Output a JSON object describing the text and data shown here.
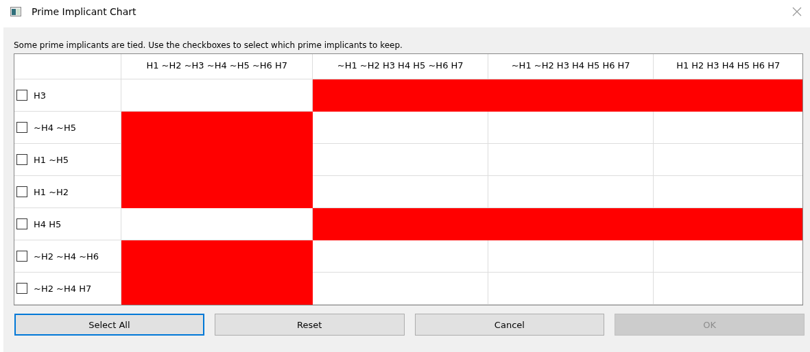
{
  "window": {
    "title": "Prime Implicant Chart"
  },
  "message": "Some prime implicants are tied. Use the checkboxes to select which prime implicants to keep.",
  "columns": [
    "H1 ~H2 ~H3 ~H4 ~H5 ~H6 H7",
    "~H1 ~H2 H3 H4 H5 ~H6 H7",
    "~H1 ~H2 H3 H4 H5 H6 H7",
    "H1 H2 H3 H4 H5 H6 H7"
  ],
  "rows": [
    {
      "label": "H3",
      "checked": false,
      "covers": [
        false,
        true,
        true,
        true
      ]
    },
    {
      "label": "~H4 ~H5",
      "checked": false,
      "covers": [
        true,
        false,
        false,
        false
      ]
    },
    {
      "label": "H1 ~H5",
      "checked": false,
      "covers": [
        true,
        false,
        false,
        false
      ]
    },
    {
      "label": "H1 ~H2",
      "checked": false,
      "covers": [
        true,
        false,
        false,
        false
      ]
    },
    {
      "label": "H4 H5",
      "checked": false,
      "covers": [
        false,
        true,
        true,
        true
      ]
    },
    {
      "label": "~H2 ~H4 ~H6",
      "checked": false,
      "covers": [
        true,
        false,
        false,
        false
      ]
    },
    {
      "label": "~H2 ~H4 H7",
      "checked": false,
      "covers": [
        true,
        false,
        false,
        false
      ]
    }
  ],
  "buttons": [
    {
      "label": "Select All",
      "focused": true,
      "disabled": false
    },
    {
      "label": "Reset",
      "focused": false,
      "disabled": false
    },
    {
      "label": "Cancel",
      "focused": false,
      "disabled": false
    },
    {
      "label": "OK",
      "focused": false,
      "disabled": true
    }
  ]
}
